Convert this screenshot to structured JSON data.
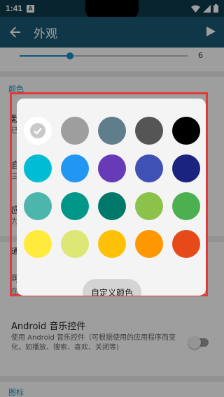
{
  "status_bar": {
    "time": "1:41",
    "notification": "A"
  },
  "app_bar": {
    "title": "外观"
  },
  "slider": {
    "value_label": "6",
    "fraction": 0.3
  },
  "sections": {
    "color": "颜色",
    "icon": "图标"
  },
  "partial_items": [
    {
      "letter": "默",
      "sub": "已"
    },
    {
      "letter": "自",
      "sub": "三"
    },
    {
      "letter": "应",
      "sub": "为"
    },
    {
      "letter": "通"
    },
    {
      "letter": "可",
      "sub": "在"
    }
  ],
  "android_controls": {
    "title": "Android 音乐控件",
    "summary": "使用 Android 音乐控件（可根据使用的应用程序而变化，如播放、搜索、喜欢、关闭等)"
  },
  "dialog": {
    "custom_color_label": "自定义颜色",
    "swatches": [
      "#ffffff",
      "#9e9e9e",
      "#607d8b",
      "#555555",
      "#000000",
      "#00bcd4",
      "#2196f3",
      "#673ab7",
      "#3f51b5",
      "#1a237e",
      "#4db6ac",
      "#009688",
      "#00796b",
      "#8bc34a",
      "#4caf50",
      "#ffeb3b",
      "#dce775",
      "#ffc107",
      "#ff9800",
      "#e64a19"
    ],
    "selected_index": 0
  }
}
